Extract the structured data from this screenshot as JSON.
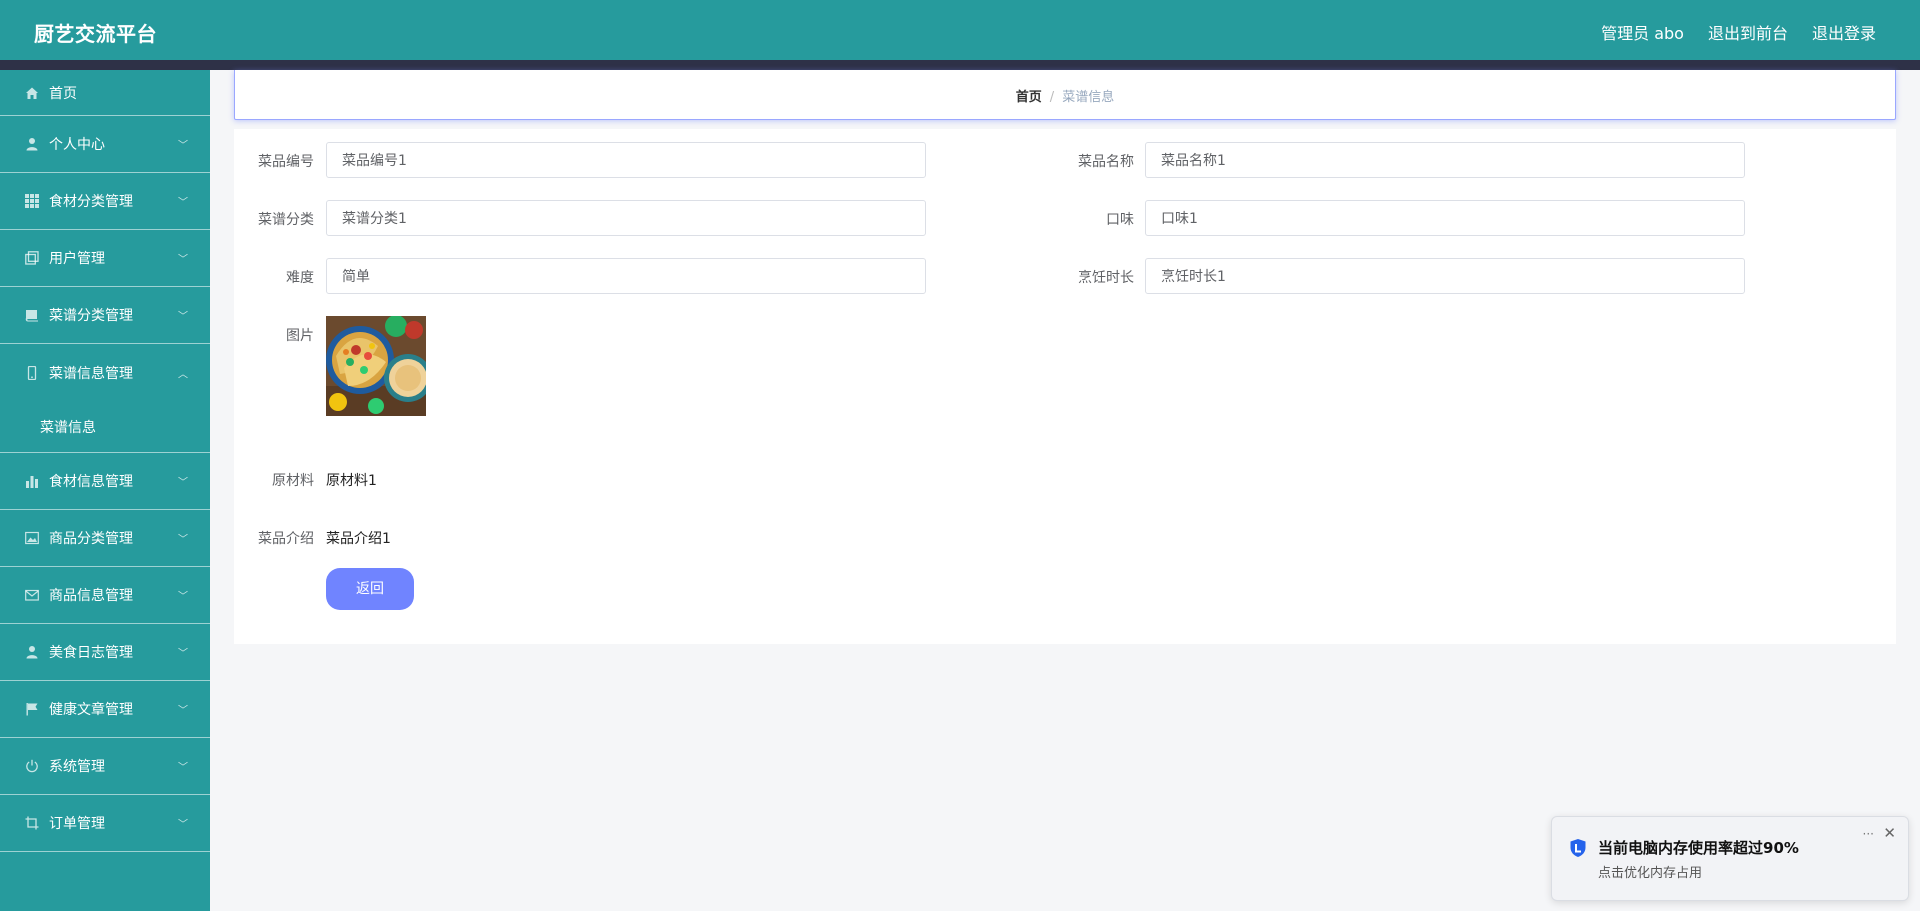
{
  "app": {
    "title": "厨艺交流平台"
  },
  "header": {
    "admin": "管理员 abo",
    "front": "退出到前台",
    "logout": "退出登录"
  },
  "sidebar": {
    "items": [
      {
        "label": "首页",
        "icon": "home-icon"
      },
      {
        "label": "个人中心",
        "icon": "user-icon"
      },
      {
        "label": "食材分类管理",
        "icon": "grid-icon"
      },
      {
        "label": "用户管理",
        "icon": "copy-icon"
      },
      {
        "label": "菜谱分类管理",
        "icon": "book-icon"
      },
      {
        "label": "菜谱信息管理",
        "icon": "phone-icon",
        "expanded": true,
        "sub": [
          {
            "label": "菜谱信息"
          }
        ]
      },
      {
        "label": "食材信息管理",
        "icon": "bar-chart-icon"
      },
      {
        "label": "商品分类管理",
        "icon": "picture-icon"
      },
      {
        "label": "商品信息管理",
        "icon": "mail-icon"
      },
      {
        "label": "美食日志管理",
        "icon": "person-icon"
      },
      {
        "label": "健康文章管理",
        "icon": "flag-icon"
      },
      {
        "label": "系统管理",
        "icon": "power-icon"
      },
      {
        "label": "订单管理",
        "icon": "crop-icon"
      }
    ]
  },
  "breadcrumb": {
    "home": "首页",
    "sep": "/",
    "current": "菜谱信息"
  },
  "form": {
    "dish_no": {
      "label": "菜品编号",
      "value": "菜品编号1"
    },
    "dish_name": {
      "label": "菜品名称",
      "value": "菜品名称1"
    },
    "category": {
      "label": "菜谱分类",
      "value": "菜谱分类1"
    },
    "taste": {
      "label": "口味",
      "value": "口味1"
    },
    "difficulty": {
      "label": "难度",
      "value": "简单"
    },
    "cook_time": {
      "label": "烹饪时长",
      "value": "烹饪时长1"
    },
    "image": {
      "label": "图片"
    },
    "ingredients": {
      "label": "原材料",
      "value": "原材料1"
    },
    "intro": {
      "label": "菜品介绍",
      "value": "菜品介绍1"
    },
    "back_label": "返回"
  },
  "notification": {
    "title": "当前电脑内存使用率超过90%",
    "subtitle": "点击优化内存占用",
    "more": "···",
    "close": "✕"
  },
  "colors": {
    "primary": "#269b9d",
    "accent": "#7084ff",
    "dark": "#2e3147"
  }
}
